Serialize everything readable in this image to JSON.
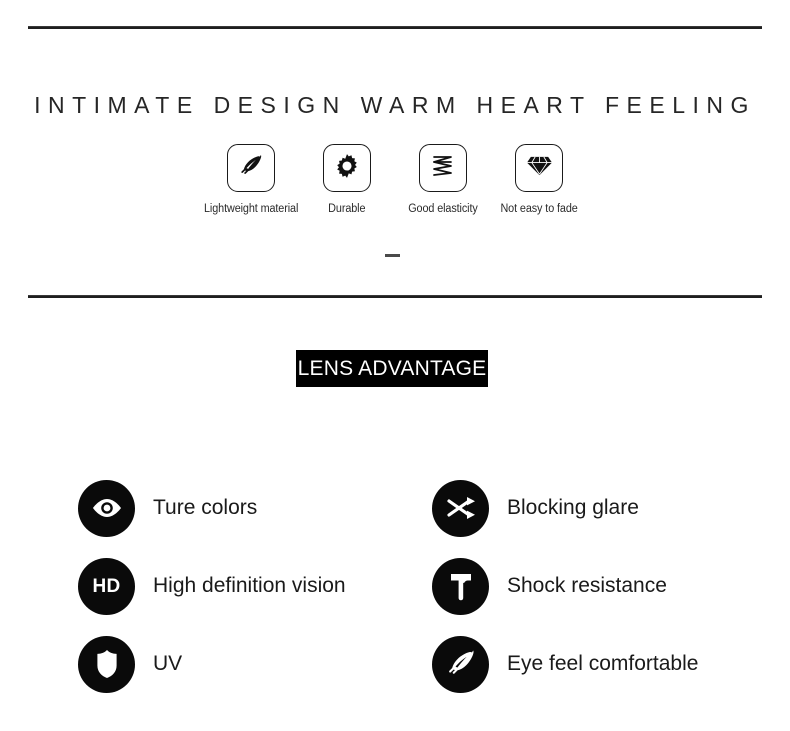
{
  "headline": "INTIMATE DESIGN WARM HEART FEELING",
  "divider_dash": "—",
  "features": [
    {
      "icon": "feather-icon",
      "label": "Lightweight material"
    },
    {
      "icon": "gear-icon",
      "label": "Durable"
    },
    {
      "icon": "zigzag-spring-icon",
      "label": "Good elasticity"
    },
    {
      "icon": "diamond-icon",
      "label": "Not easy to fade"
    }
  ],
  "banner": {
    "title": "LENS ADVANTAGE",
    "background_color": "#000000",
    "text_color": "#ffffff"
  },
  "advantages": [
    {
      "icon": "eye-icon",
      "label": "Ture colors"
    },
    {
      "icon": "shuffle-arrows-icon",
      "label": "Blocking glare"
    },
    {
      "icon": "hd-badge-icon",
      "label": "High definition vision",
      "badge_text": "HD"
    },
    {
      "icon": "hammer-icon",
      "label": "Shock resistance"
    },
    {
      "icon": "shield-icon",
      "label": "UV"
    },
    {
      "icon": "feather-icon",
      "label": "Eye feel comfortable"
    }
  ],
  "colors": {
    "ink": "#1a1a1a",
    "rule": "#1f1f1f",
    "badge": "#0a0a0a",
    "background": "#ffffff"
  }
}
